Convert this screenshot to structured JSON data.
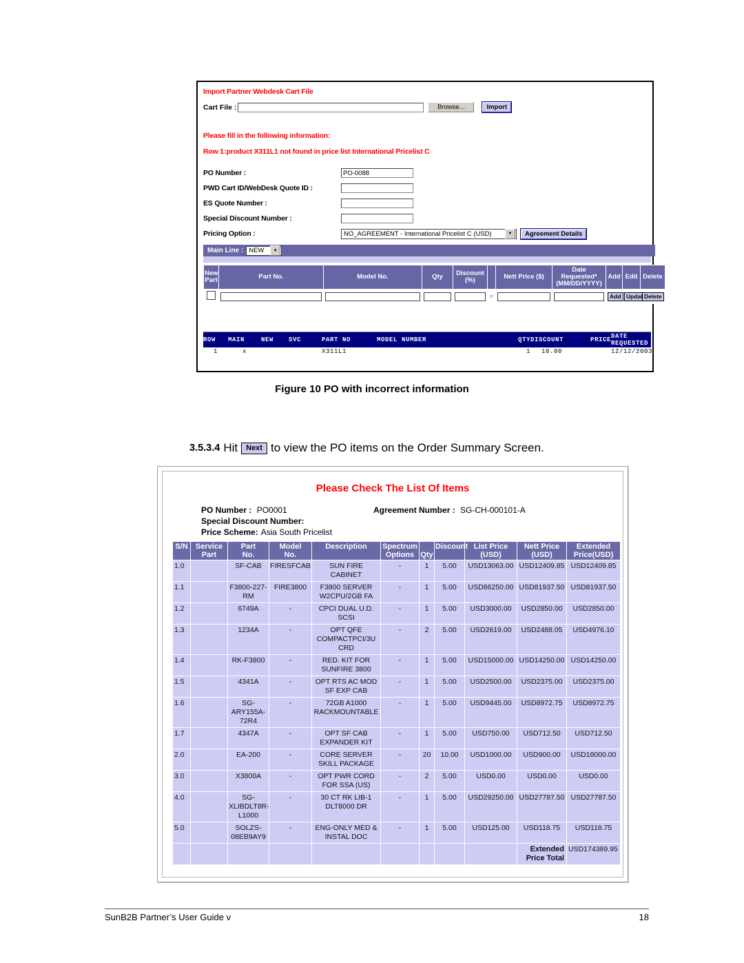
{
  "figure1": {
    "import_section_title": "Import Partner Webdesk Cart File",
    "cart_file_label": "Cart File :",
    "cart_file_value": "",
    "browse_button": "Browse...",
    "import_button": "Import",
    "fill_message": "Please fill in the following information:",
    "error_message": "Row 1:product X311L1 not found in price list International Pricelist C",
    "fields": [
      {
        "label": "PO Number :",
        "value": "PO-0088"
      },
      {
        "label": "PWD Cart ID/WebDesk Quote ID :",
        "value": ""
      },
      {
        "label": "ES Quote Number :",
        "value": ""
      },
      {
        "label": "Special Discount Number :",
        "value": ""
      }
    ],
    "pricing_option_label": "Pricing Option :",
    "pricing_option_value": "NO_AGREEMENT - International Pricelist C (USD)",
    "agreement_details_button": "Agreement Details",
    "main_line_label": "Main Line :",
    "main_line_value": "NEW",
    "parts_table": {
      "headers": [
        "New Part",
        "Part No.",
        "Model No.",
        "Qty",
        "Discount (%)",
        "",
        "Nett Price ($)",
        "Date Requested* (MM/DD/YYYY)",
        "Add",
        "Edit",
        "Delete"
      ],
      "header_newpart_l1": "New",
      "header_newpart_l2": "Part",
      "header_partno": "Part No.",
      "header_modelno": "Model No.",
      "header_qty": "Qty",
      "header_discount_l1": "Discount",
      "header_discount_l2": "(%)",
      "header_nettprice": "Nett Price ($)",
      "header_date_l1": "Date",
      "header_date_l2": "Requested*",
      "header_date_l3": "(MM/DD/YYYY)",
      "header_add": "Add",
      "header_edit": "Edit",
      "header_delete": "Delete",
      "or_text": "or",
      "row_add_button": "Add",
      "row_update_button": "Update",
      "row_delete_button": "Delete"
    },
    "mono_listing": {
      "headers": [
        "ROW",
        "MAIN",
        "NEW",
        "SVC",
        "PART NO",
        "MODEL NUMBER",
        "QTY",
        "DISCOUNT",
        "PRICE",
        "DATE REQUESTED"
      ],
      "rows": [
        {
          "row": "1",
          "main": "x",
          "new": "",
          "svc": "",
          "part_no": "X311L1",
          "model_number": "",
          "qty": "1",
          "discount": "10.00",
          "price": "",
          "date_requested": "12/12/2003"
        }
      ]
    }
  },
  "figure1_caption": "Figure 10  PO with incorrect information",
  "section": {
    "number": "3.5.3.4",
    "text_before": "Hit",
    "button_label": "Next",
    "text_after": "to view the PO items on the Order Summary Screen."
  },
  "figure2": {
    "title": "Please Check The List Of Items",
    "po_number_label": "PO Number :",
    "po_number_value": "PO0001",
    "agreement_number_label": "Agreement Number :",
    "agreement_number_value": "SG-CH-000101-A",
    "special_discount_label": "Special Discount Number:",
    "special_discount_value": "",
    "price_scheme_label": "Price Scheme:",
    "price_scheme_value": "Asia South Pricelist",
    "headers": {
      "sn": "S/N",
      "service_part_l1": "Service",
      "service_part_l2": "Part",
      "part_no_l1": "Part",
      "part_no_l2": "No.",
      "model_no_l1": "Model",
      "model_no_l2": "No.",
      "description": "Description",
      "spectrum_l1": "Spectrum",
      "spectrum_l2": "Options",
      "qty": "Qty",
      "discount": "Discount",
      "list_price_l1": "List Price",
      "list_price_l2": "(USD)",
      "nett_price_l1": "Nett Price",
      "nett_price_l2": "(USD)",
      "extended_l1": "Extended",
      "extended_l2": "Price(USD)"
    },
    "rows": [
      {
        "sn": "1.0",
        "service_part": "",
        "part_no": "SF-CAB",
        "model_no": "FIRESFCAB",
        "description": "SUN FIRE CABINET",
        "spectrum": "-",
        "qty": "1",
        "discount": "5.00",
        "list_price": "USD13063.00",
        "nett_price": "USD12409.85",
        "extended": "USD12409.85"
      },
      {
        "sn": "1.1",
        "service_part": "",
        "part_no": "F3800-227-RM",
        "model_no": "FIRE3800",
        "description": "F3800 SERVER W2CPU/2GB FA",
        "spectrum": "-",
        "qty": "1",
        "discount": "5.00",
        "list_price": "USD86250.00",
        "nett_price": "USD81937.50",
        "extended": "USD81937.50"
      },
      {
        "sn": "1.2",
        "service_part": "",
        "part_no": "6749A",
        "model_no": "-",
        "description": "CPCI DUAL U.D. SCSI",
        "spectrum": "-",
        "qty": "1",
        "discount": "5.00",
        "list_price": "USD3000.00",
        "nett_price": "USD2850.00",
        "extended": "USD2850.00"
      },
      {
        "sn": "1.3",
        "service_part": "",
        "part_no": "1234A",
        "model_no": "-",
        "description": "OPT QFE COMPACTPCI/3U CRD",
        "spectrum": "-",
        "qty": "2",
        "discount": "5.00",
        "list_price": "USD2619.00",
        "nett_price": "USD2488.05",
        "extended": "USD4976.10"
      },
      {
        "sn": "1.4",
        "service_part": "",
        "part_no": "RK-F3800",
        "model_no": "-",
        "description": "RED. KIT FOR SUNFIRE 3800",
        "spectrum": "-",
        "qty": "1",
        "discount": "5.00",
        "list_price": "USD15000.00",
        "nett_price": "USD14250.00",
        "extended": "USD14250.00"
      },
      {
        "sn": "1.5",
        "service_part": "",
        "part_no": "4341A",
        "model_no": "-",
        "description": "OPT RTS AC MOD SF EXP CAB",
        "spectrum": "-",
        "qty": "1",
        "discount": "5.00",
        "list_price": "USD2500.00",
        "nett_price": "USD2375.00",
        "extended": "USD2375.00"
      },
      {
        "sn": "1.6",
        "service_part": "",
        "part_no": "SG-ARY155A-72R4",
        "model_no": "-",
        "description": "72GB A1000 RACKMOUNTABLE",
        "spectrum": "-",
        "qty": "1",
        "discount": "5.00",
        "list_price": "USD9445.00",
        "nett_price": "USD8972.75",
        "extended": "USD8972.75"
      },
      {
        "sn": "1.7",
        "service_part": "",
        "part_no": "4347A",
        "model_no": "-",
        "description": "OPT SF CAB EXPANDER KIT",
        "spectrum": "-",
        "qty": "1",
        "discount": "5.00",
        "list_price": "USD750.00",
        "nett_price": "USD712.50",
        "extended": "USD712.50"
      },
      {
        "sn": "2.0",
        "service_part": "",
        "part_no": "EA-200",
        "model_no": "-",
        "description": "CORE SERVER SKILL PACKAGE",
        "spectrum": "-",
        "qty": "20",
        "discount": "10.00",
        "list_price": "USD1000.00",
        "nett_price": "USD900.00",
        "extended": "USD18000.00"
      },
      {
        "sn": "3.0",
        "service_part": "",
        "part_no": "X3800A",
        "model_no": "-",
        "description": "OPT PWR CORD FOR SSA (US)",
        "spectrum": "-",
        "qty": "2",
        "discount": "5.00",
        "list_price": "USD0.00",
        "nett_price": "USD0.00",
        "extended": "USD0.00"
      },
      {
        "sn": "4.0",
        "service_part": "",
        "part_no": "SG-XLIBDLT8R-L1000",
        "model_no": "-",
        "description": "30 CT RK LIB-1 DLT8000 DR",
        "spectrum": "-",
        "qty": "1",
        "discount": "5.00",
        "list_price": "USD29250.00",
        "nett_price": "USD27787.50",
        "extended": "USD27787.50"
      },
      {
        "sn": "5.0",
        "service_part": "",
        "part_no": "SOLZS-08EB9AY9",
        "model_no": "-",
        "description": "ENG-ONLY MED & INSTAL DOC",
        "spectrum": "-",
        "qty": "1",
        "discount": "5.00",
        "list_price": "USD125.00",
        "nett_price": "USD118.75",
        "extended": "USD118.75"
      }
    ],
    "total_label_l1": "Extended",
    "total_label_l2": "Price Total",
    "total_value": "USD174389.95"
  },
  "footer": {
    "left": "SunB2B Partner’s User Guide v",
    "page": "18"
  }
}
